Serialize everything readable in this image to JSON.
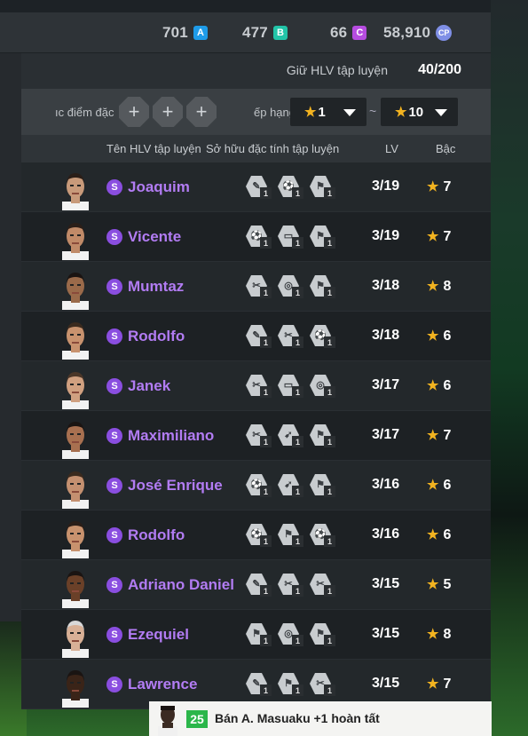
{
  "currencies": [
    {
      "value": "701",
      "badge": "A",
      "icon": "currency-a-icon"
    },
    {
      "value": "477",
      "badge": "B",
      "icon": "currency-b-icon"
    },
    {
      "value": "66",
      "badge": "C",
      "icon": "currency-c-icon"
    },
    {
      "value": "58,910",
      "badge": "CP",
      "icon": "cp-coin-icon"
    }
  ],
  "holder": {
    "label": "Giữ HLV tập luyện",
    "count": "40/200"
  },
  "filters": {
    "trait_label": "ıc điểm đặc",
    "rank_label": "ếp hạng",
    "plus": "+",
    "tilde": "~",
    "rank_min": "1",
    "rank_max": "10"
  },
  "columns": {
    "name": "Tên HLV tập luyện",
    "traits": "Sở hữu đặc tính tập luyện",
    "lv": "LV",
    "rank": "Bậc"
  },
  "coaches": [
    {
      "name": "Joaquim",
      "lv": "3/19",
      "rank": "7",
      "traits": [
        "1",
        "1",
        "1"
      ]
    },
    {
      "name": "Vicente",
      "lv": "3/19",
      "rank": "7",
      "traits": [
        "1",
        "1",
        "1"
      ]
    },
    {
      "name": "Mumtaz",
      "lv": "3/18",
      "rank": "8",
      "traits": [
        "1",
        "1",
        "1"
      ]
    },
    {
      "name": "Rodolfo",
      "lv": "3/18",
      "rank": "6",
      "traits": [
        "1",
        "1",
        "1"
      ]
    },
    {
      "name": "Janek",
      "lv": "3/17",
      "rank": "6",
      "traits": [
        "1",
        "1",
        "1"
      ]
    },
    {
      "name": "Maximiliano",
      "lv": "3/17",
      "rank": "7",
      "traits": [
        "1",
        "1",
        "1"
      ]
    },
    {
      "name": "José Enrique",
      "lv": "3/16",
      "rank": "6",
      "traits": [
        "1",
        "1",
        "1"
      ]
    },
    {
      "name": "Rodolfo",
      "lv": "3/16",
      "rank": "6",
      "traits": [
        "1",
        "1",
        "1"
      ]
    },
    {
      "name": "Adriano Daniel",
      "lv": "3/15",
      "rank": "5",
      "traits": [
        "1",
        "1",
        "1"
      ]
    },
    {
      "name": "Ezequiel",
      "lv": "3/15",
      "rank": "8",
      "traits": [
        "1",
        "1",
        "1"
      ]
    },
    {
      "name": "Lawrence",
      "lv": "3/15",
      "rank": "7",
      "traits": [
        "1",
        "1",
        "1"
      ]
    }
  ],
  "toast": {
    "rating": "25",
    "text": "Bán A. Masuaku +1 hoàn tất"
  },
  "colors": {
    "accent_purple": "#b27cf3",
    "star": "#f2b320",
    "rating_green": "#2bb64a"
  }
}
